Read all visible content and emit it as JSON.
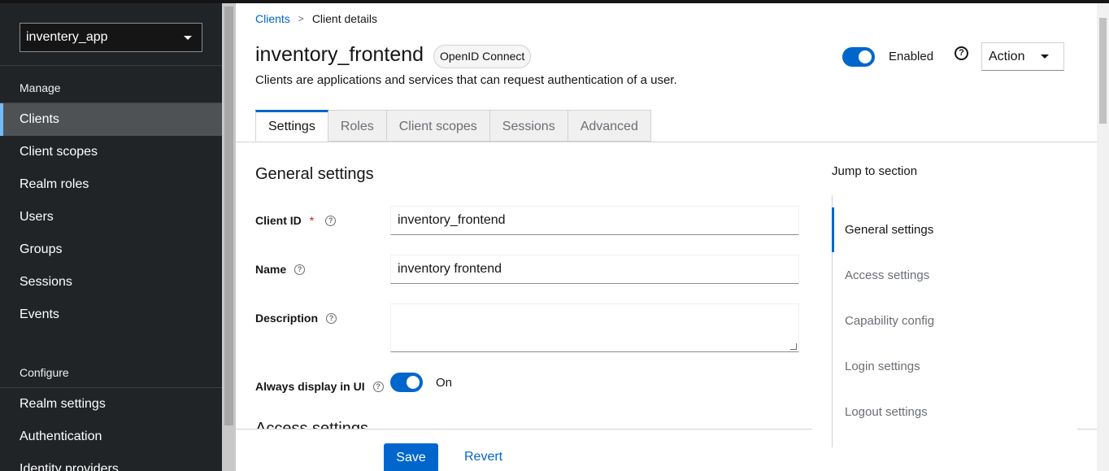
{
  "sidebar": {
    "realm": "inventery_app",
    "manage_heading": "Manage",
    "manage_items": [
      "Clients",
      "Client scopes",
      "Realm roles",
      "Users",
      "Groups",
      "Sessions",
      "Events"
    ],
    "configure_heading": "Configure",
    "configure_items": [
      "Realm settings",
      "Authentication",
      "Identity providers"
    ]
  },
  "breadcrumb": {
    "parent": "Clients",
    "separator": ">",
    "current": "Client details"
  },
  "header": {
    "title": "inventory_frontend",
    "badge": "OpenID Connect",
    "subtitle": "Clients are applications and services that can request authentication of a user.",
    "enabled_label": "Enabled",
    "enabled": true,
    "help_icon": "question-circle-icon",
    "action_label": "Action"
  },
  "tabs": [
    {
      "label": "Settings",
      "active": true
    },
    {
      "label": "Roles"
    },
    {
      "label": "Client scopes"
    },
    {
      "label": "Sessions"
    },
    {
      "label": "Advanced"
    }
  ],
  "form": {
    "section_title": "General settings",
    "client_id_label": "Client ID",
    "required_mark": "*",
    "client_id_value": "inventory_frontend",
    "name_label": "Name",
    "name_value": "inventory frontend",
    "description_label": "Description",
    "description_value": "",
    "always_display_label": "Always display in UI",
    "always_display_value": "On",
    "next_section_title": "Access settings"
  },
  "footer": {
    "save_label": "Save",
    "revert_label": "Revert"
  },
  "jump": {
    "title": "Jump to section",
    "items": [
      "General settings",
      "Access settings",
      "Capability config",
      "Login settings",
      "Logout settings"
    ],
    "active_index": 0
  },
  "colors": {
    "primary": "#0066cc",
    "sidebar_bg": "#212427",
    "active_accent": "#73bcf7"
  }
}
